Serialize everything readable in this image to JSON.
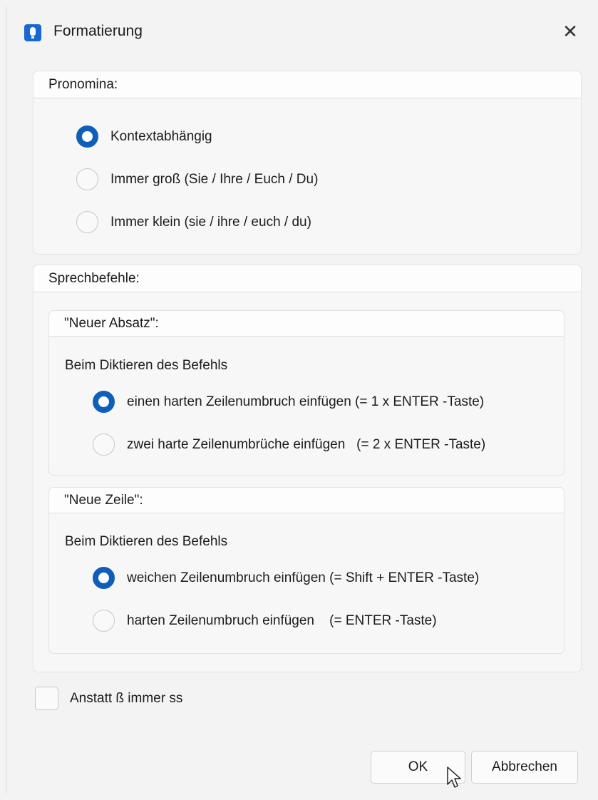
{
  "window": {
    "title": "Formatierung",
    "close_symbol": "✕",
    "app_icon": "microphone-app-icon"
  },
  "pronomina": {
    "title": "Pronomina:",
    "options": [
      {
        "label": "Kontextabhängig",
        "checked": true
      },
      {
        "label": "Immer groß (Sie / Ihre / Euch / Du)",
        "checked": false
      },
      {
        "label": "Immer klein (sie / ihre / euch / du)",
        "checked": false
      }
    ]
  },
  "sprechbefehle": {
    "title": "Sprechbefehle:",
    "neuer_absatz": {
      "title": "\"Neuer Absatz\":",
      "description": "Beim Diktieren des Befehls",
      "options": [
        {
          "label": "einen harten Zeilenumbruch einfügen (= 1 x ENTER -Taste)",
          "checked": true
        },
        {
          "label": "zwei harte Zeilenumbrüche einfügen   (= 2 x ENTER -Taste)",
          "checked": false
        }
      ]
    },
    "neue_zeile": {
      "title": "\"Neue Zeile\":",
      "description": "Beim Diktieren des Befehls",
      "options": [
        {
          "label": "weichen Zeilenumbruch einfügen (= Shift + ENTER -Taste)",
          "checked": true
        },
        {
          "label": "harten Zeilenumbruch einfügen    (= ENTER -Taste)",
          "checked": false
        }
      ]
    }
  },
  "ss_option": {
    "label": "Anstatt ß immer ss",
    "checked": false
  },
  "buttons": {
    "ok": "OK",
    "cancel": "Abbrechen"
  },
  "colors": {
    "accent": "#0f5fb8",
    "app_icon": "#1967d2"
  }
}
